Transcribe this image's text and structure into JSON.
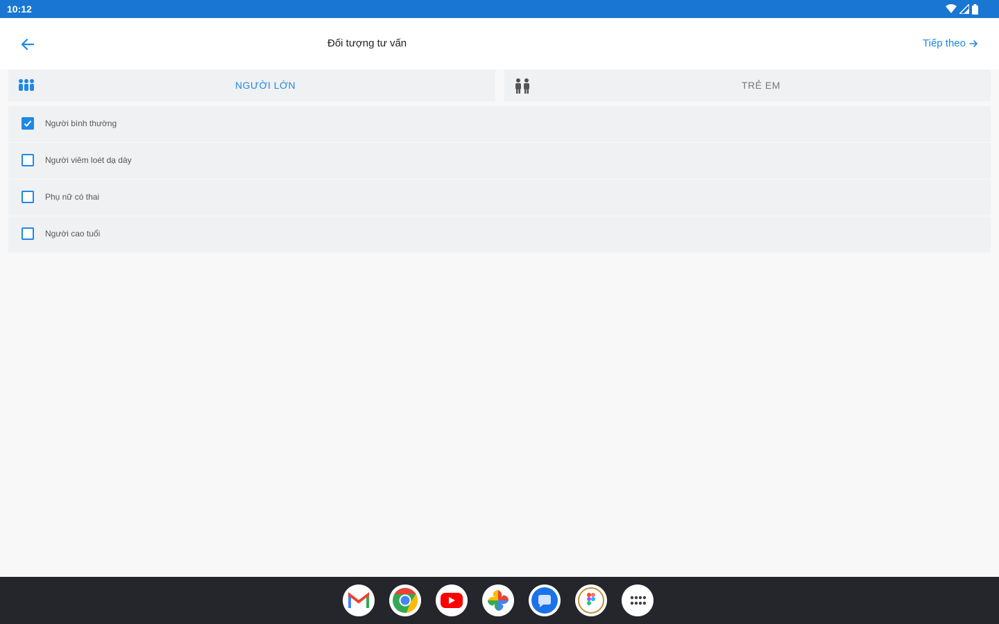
{
  "status_bar": {
    "time": "10:12",
    "icons": [
      "wifi-icon",
      "signal-icon",
      "battery-icon"
    ]
  },
  "app_bar": {
    "title": "Đối tượng tư vấn",
    "next_label": "Tiếp theo",
    "back_icon": "arrow-back-icon",
    "next_icon": "arrow-forward-icon"
  },
  "tabs": [
    {
      "label": "NGƯỜI LỚN",
      "icon": "adults-group-icon",
      "selected": true
    },
    {
      "label": "TRẺ EM",
      "icon": "children-icon",
      "selected": false
    }
  ],
  "options": [
    {
      "label": "Người bình thường",
      "checked": true
    },
    {
      "label": "Người  viêm  loét dạ dày",
      "checked": false
    },
    {
      "label": "Phụ nữ có thai",
      "checked": false
    },
    {
      "label": "Người cao tuổi",
      "checked": false
    }
  ],
  "taskbar": {
    "apps": [
      "gmail-icon",
      "chrome-icon",
      "youtube-icon",
      "photos-icon",
      "messages-icon",
      "figma-icon",
      "app-launcher-icon"
    ]
  },
  "colors": {
    "accent": "#1e88e5",
    "status_bar": "#1976d2",
    "taskbar": "#24262b",
    "tab_bg": "#eff1f3"
  }
}
